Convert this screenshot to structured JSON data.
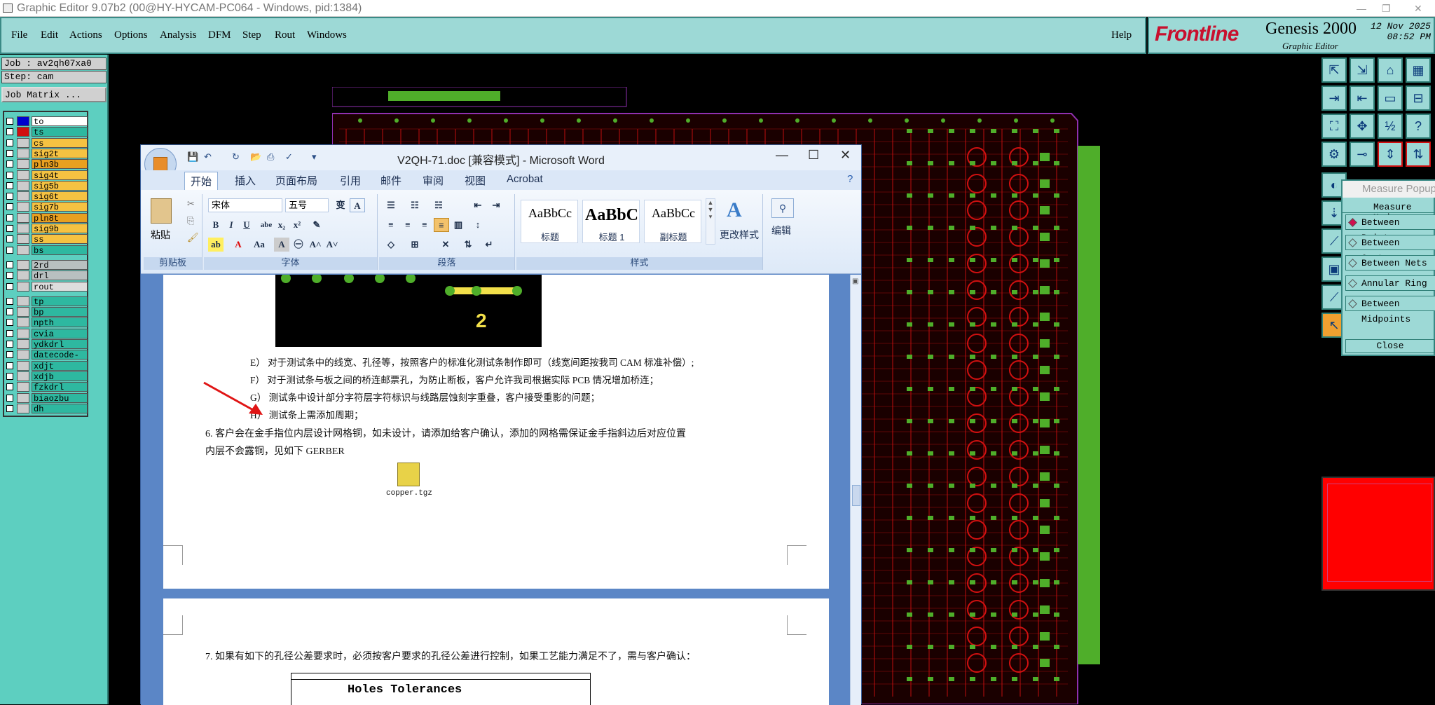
{
  "genesis": {
    "window_title": "Graphic Editor 9.07b2 (00@HY-HYCAM-PC064 - Windows, pid:1384)",
    "menu": [
      "File",
      "Edit",
      "Actions",
      "Options",
      "Analysis",
      "DFM",
      "Step",
      "Rout",
      "Windows"
    ],
    "help": "Help",
    "logo_frontline": "Frontline",
    "logo_genesis": "Genesis 2000",
    "logo_subtitle": "Graphic Editor",
    "date": "12 Nov 2025",
    "time": "08:52 PM",
    "job_label": "Job : av2qh07xa0",
    "step_label": "Step: cam",
    "job_matrix": "Job Matrix ...",
    "layers_group1": [
      "to",
      "ts",
      "cs",
      "sig2t",
      "pln3b",
      "sig4t",
      "sig5b",
      "sig6t",
      "sig7b",
      "pln8t",
      "sig9b",
      "ss",
      "bs"
    ],
    "layers_group2": [
      "2rd",
      "drl",
      "rout"
    ],
    "layers_group3": [
      "tp",
      "bp",
      "npth",
      "cvia",
      "ydkdrl",
      "datecode-pth",
      "xdjt",
      "xdjb",
      "fzkdrl",
      "biaozbu",
      "dh"
    ],
    "colors": {
      "ss": "#2eb8a0",
      "layer_yellow": "#f5c242",
      "layer_orange": "#e8a020",
      "layer_gray": "#b8c0c0",
      "pcb_red": "#d01010",
      "pcb_green": "#4fae2a",
      "accent_teal": "#9dd9d6"
    },
    "measure": {
      "title": "Measure Popup",
      "mode_label": "Measure Mode",
      "options": [
        "Between Points",
        "Between Contours",
        "Between Nets",
        "Annular Ring",
        "Between Midpoints"
      ],
      "close": "Close"
    }
  },
  "word": {
    "title": "V2QH-71.doc [兼容模式] - Microsoft Word",
    "tabs": [
      "开始",
      "插入",
      "页面布局",
      "引用",
      "邮件",
      "审阅",
      "视图",
      "Acrobat"
    ],
    "clipboard": {
      "paste": "粘贴",
      "group": "剪贴板"
    },
    "font": {
      "name": "宋体",
      "size": "五号",
      "group": "字体"
    },
    "paragraph": {
      "group": "段落"
    },
    "styles": {
      "items": [
        {
          "sample": "AaBbCc",
          "name": "标题"
        },
        {
          "sample": "AaBbC",
          "name": "标题 1"
        },
        {
          "sample": "AaBbCc",
          "name": "副标题"
        }
      ],
      "change": "更改样式",
      "group": "样式"
    },
    "edit": "编辑",
    "image_label": "2",
    "lines": {
      "e": "E） 对于测试条中的线宽、孔径等，按照客户的标准化测试条制作即可（线宽间距按我司 CAM 标准补偿）;",
      "f": "F） 对于测试条与板之间的桥连邮票孔，为防止断板，客户允许我司根据实际 PCB 情况增加桥连；",
      "g": "G） 测试条中设计部分字符层字符标识与线路层蚀刻字重叠，客户接受重影的问题；",
      "h": "H） 测试条上需添加周期；",
      "p6a": "6.  客户会在金手指位内层设计网格铜，如未设计，请添加给客户确认，添加的网格需保证金手指斜边后对应位置",
      "p6b": "内层不会露铜，见如下 GERBER",
      "attachment": "copper.tgz",
      "p7": "7. 如果有如下的孔径公差要求时，必须按客户要求的孔径公差进行控制，如果工艺能力满足不了，需与客户确认：",
      "table_head": "Holes Tolerances"
    }
  }
}
